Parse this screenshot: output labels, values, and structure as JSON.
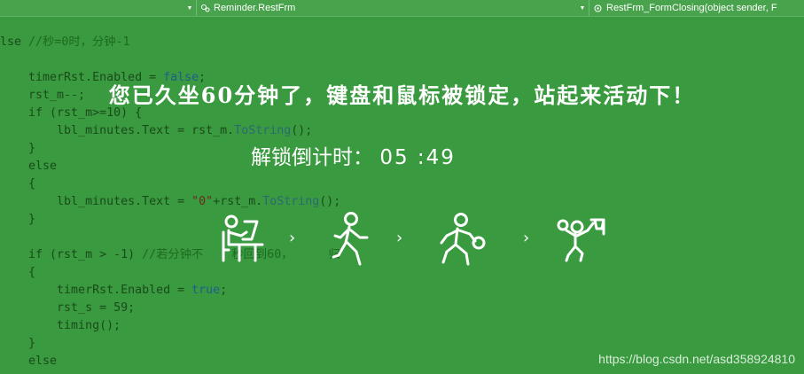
{
  "toolbar": {
    "combo_left": "",
    "combo_class": "Reminder.RestFrm",
    "combo_member": "RestFrm_FormClosing(object sender, F"
  },
  "code_lines": [
    "lse //秒=0时，分钟-1",
    "",
    "    timerRst.Enabled = false;",
    "    rst_m--;",
    "    if (rst_m>=10) {",
    "        lbl_minutes.Text = rst_m.ToString();",
    "    }",
    "    else",
    "    {",
    "        lbl_minutes.Text = \"0\"+rst_m.ToString();",
    "    }",
    "",
    "    if (rst_m > -1) //若分钟不    秒回到60，     归",
    "    {",
    "        timerRst.Enabled = true;",
    "        rst_s = 59;",
    "        timing();",
    "    }",
    "    else"
  ],
  "overlay": {
    "message": "您已久坐60分钟了，键盘和鼠标被锁定，站起来活动下！",
    "countdown_label": "解锁倒计时：",
    "countdown_minutes": "05",
    "countdown_sep": ":",
    "countdown_seconds": "49"
  },
  "steps": {
    "chevron": "›",
    "icons": [
      "person-at-computer-icon",
      "walking-person-icon",
      "ball-player-icon",
      "basketball-player-icon"
    ]
  },
  "watermark": "https://blog.csdn.net/asd358924810",
  "colors": {
    "background": "#3a9a3f",
    "overlay_text": "#ffffff",
    "code_text": "#1b4a1c"
  }
}
